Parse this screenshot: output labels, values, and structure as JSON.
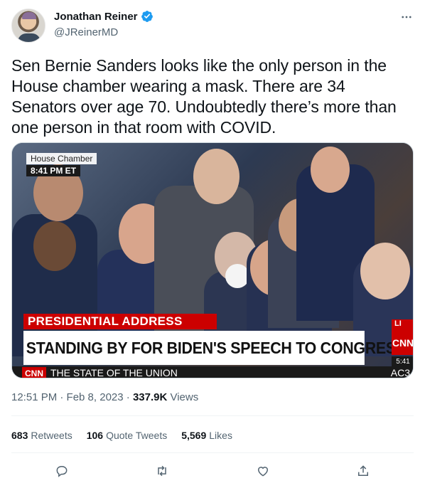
{
  "author": {
    "name": "Jonathan Reiner",
    "handle": "@JReinerMD",
    "verified": true
  },
  "tweet": {
    "text": "Sen Bernie Sanders looks like the only person in the House chamber wearing a mask. There are 34 Senators over age 70. Undoubtedly there’s more than one person in that room with COVID."
  },
  "media": {
    "tag_line1": "House Chamber",
    "tag_line2": "8:41 PM ET",
    "banner_red": "PRESIDENTIAL ADDRESS",
    "banner_main": "STANDING BY FOR BIDEN'S SPEECH TO CONGRESS",
    "network_logo": "CNN",
    "live_tag": "LI",
    "clock": "5:41",
    "ticker_logo": "CNN",
    "ticker_text": "THE STATE OF THE UNION",
    "ticker_tail": "AC3"
  },
  "meta": {
    "time": "12:51 PM · Feb 8, 2023 · ",
    "views_count": "337.9K",
    "views_label": " Views"
  },
  "stats": {
    "retweets_count": "683",
    "retweets_label": "Retweets",
    "quotes_count": "106",
    "quotes_label": "Quote Tweets",
    "likes_count": "5,569",
    "likes_label": "Likes"
  },
  "icons": {
    "more": "more-icon",
    "reply": "reply-icon",
    "retweet": "retweet-icon",
    "like": "heart-icon",
    "share": "share-icon",
    "verified": "verified-badge-icon"
  },
  "colors": {
    "accent": "#1d9bf0",
    "text": "#0f1419",
    "secondary": "#536471",
    "cnn_red": "#cc0000"
  }
}
